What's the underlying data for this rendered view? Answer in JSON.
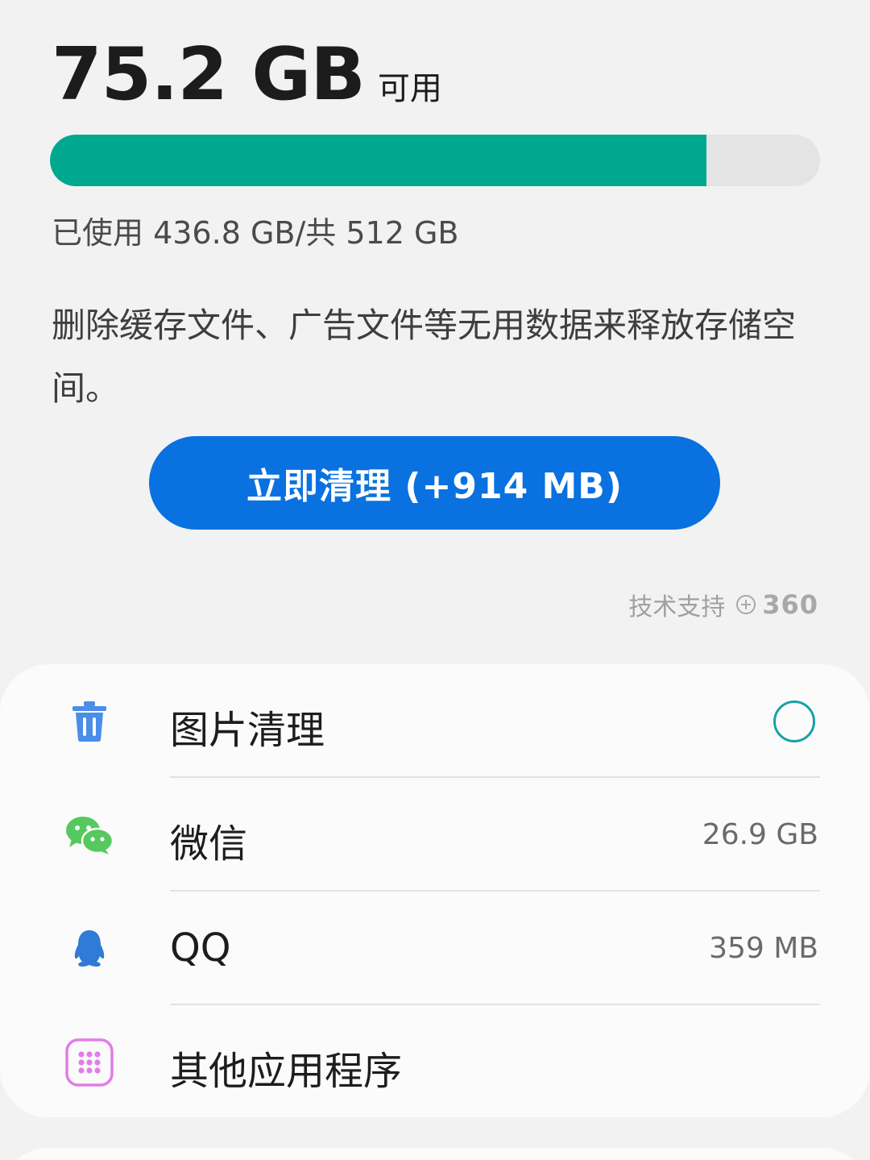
{
  "storage": {
    "free_value": "75.2 GB",
    "free_label": "可用",
    "used_fraction": 0.853,
    "usage_text": "已使用 436.8 GB/共 512 GB",
    "bar_fill_color": "#00a88f",
    "bar_track_color": "#e4e4e4"
  },
  "description": "删除缓存文件、广告文件等无用数据来释放存储空间。",
  "clean_button": {
    "label": "立即清理 (+914 MB)",
    "color": "#0a71e0"
  },
  "support": {
    "text": "技术支持",
    "brand": "360",
    "icon": "plus-circle-icon"
  },
  "items": [
    {
      "icon": "trash-icon",
      "label": "图片清理",
      "value": "",
      "control": "radio"
    },
    {
      "icon": "wechat-icon",
      "label": "微信",
      "value": "26.9 GB"
    },
    {
      "icon": "qq-penguin-icon",
      "label": "QQ",
      "value": "359 MB"
    },
    {
      "icon": "apps-grid-icon",
      "label": "其他应用程序",
      "value": ""
    }
  ],
  "colors": {
    "trash": "#4a8ee8",
    "wechat": "#55c95f",
    "qq": "#2f7bd6",
    "apps": "#e27ce8",
    "radio": "#17a2a4"
  }
}
